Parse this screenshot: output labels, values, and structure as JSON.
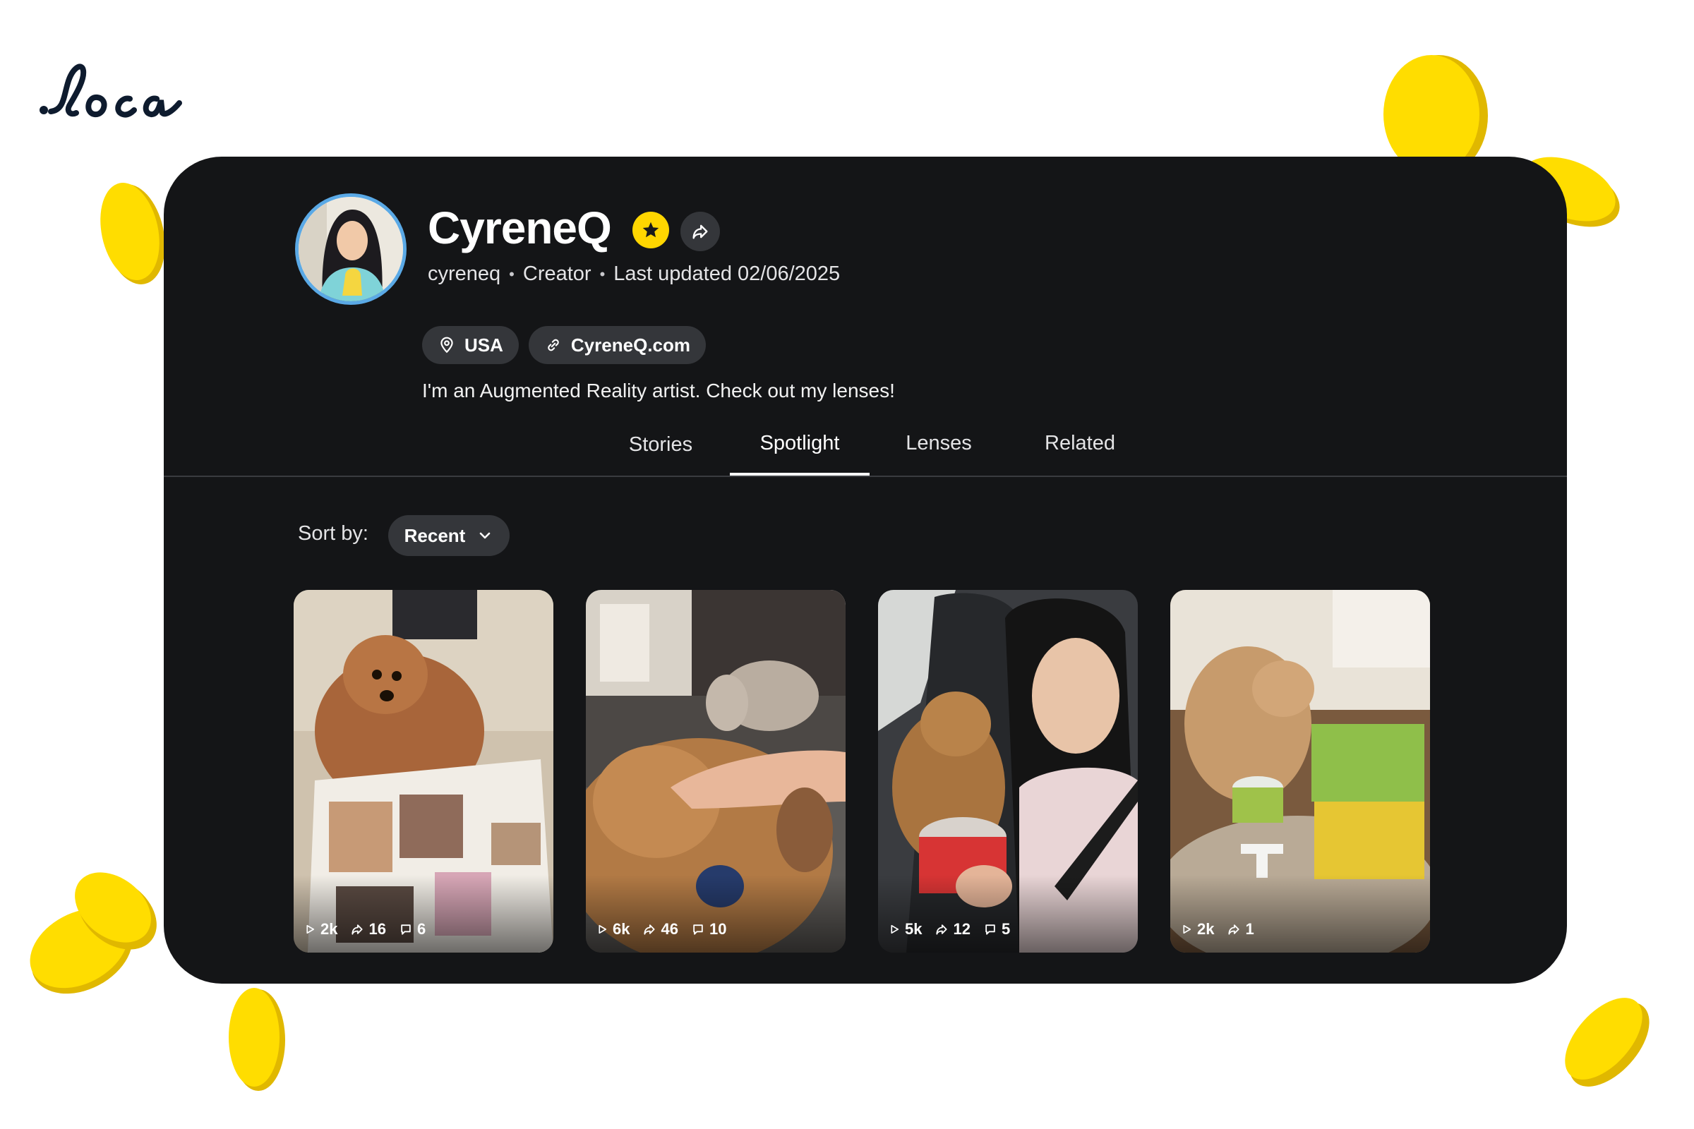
{
  "brand": {
    "logo_text": "loca"
  },
  "profile": {
    "display_name": "CyreneQ",
    "username": "cyreneq",
    "role": "Creator",
    "last_updated": "Last updated 02/06/2025",
    "location": "USA",
    "website": "CyreneQ.com",
    "bio": "I'm an Augmented Reality artist. Check out my lenses!"
  },
  "tabs": [
    {
      "label": "Stories",
      "active": false
    },
    {
      "label": "Spotlight",
      "active": true
    },
    {
      "label": "Lenses",
      "active": false
    },
    {
      "label": "Related",
      "active": false
    }
  ],
  "sort": {
    "label": "Sort by:",
    "value": "Recent"
  },
  "spotlight_items": [
    {
      "views": "2k",
      "shares": "16",
      "comments": "6"
    },
    {
      "views": "6k",
      "shares": "46",
      "comments": "10"
    },
    {
      "views": "5k",
      "shares": "12",
      "comments": "5"
    },
    {
      "views": "2k",
      "shares": "1",
      "comments": ""
    }
  ],
  "colors": {
    "card_bg": "#141517",
    "chip_bg": "#34363a",
    "badge": "#ffd600",
    "coin": "#ffdd00",
    "avatar_ring": "#5aa9e6"
  },
  "icons": [
    "location-pin-icon",
    "link-icon",
    "star-badge-icon",
    "share-arrow-icon",
    "chevron-down-icon",
    "play-icon",
    "share-icon",
    "comment-icon"
  ]
}
